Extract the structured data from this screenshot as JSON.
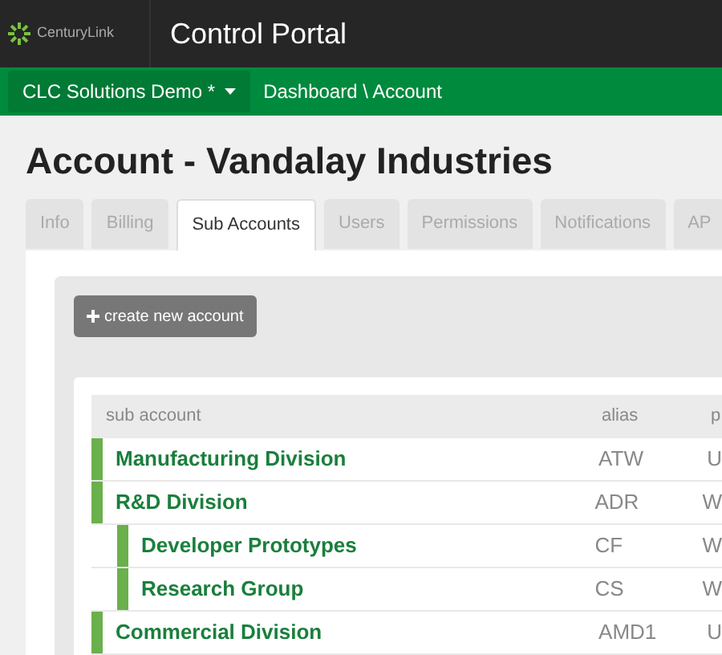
{
  "header": {
    "logo_text": "CenturyLink",
    "title": "Control Portal"
  },
  "nav": {
    "account_menu": "CLC Solutions Demo *",
    "breadcrumb": "Dashboard \\ Account"
  },
  "page_title": "Account - Vandalay Industries",
  "tabs": [
    {
      "label": "Info",
      "selected": false
    },
    {
      "label": "Billing",
      "selected": false
    },
    {
      "label": "Sub Accounts",
      "selected": true
    },
    {
      "label": "Users",
      "selected": false
    },
    {
      "label": "Permissions",
      "selected": false
    },
    {
      "label": "Notifications",
      "selected": false
    },
    {
      "label": "AP",
      "selected": false
    }
  ],
  "create_button": "create new account",
  "table": {
    "columns": [
      "sub account",
      "alias",
      "p"
    ],
    "rows": [
      {
        "name": "Manufacturing Division",
        "alias": "ATW",
        "column_3": "U"
      },
      {
        "name": "R&D Division",
        "alias": "ADR",
        "column_3": "W",
        "children": [
          {
            "name": "Developer Prototypes",
            "alias": "CF",
            "column_3": "W"
          },
          {
            "name": "Research Group",
            "alias": "CS",
            "column_3": "W"
          }
        ]
      },
      {
        "name": "Commercial Division",
        "alias": "AMD1",
        "column_3": "U"
      }
    ]
  }
}
